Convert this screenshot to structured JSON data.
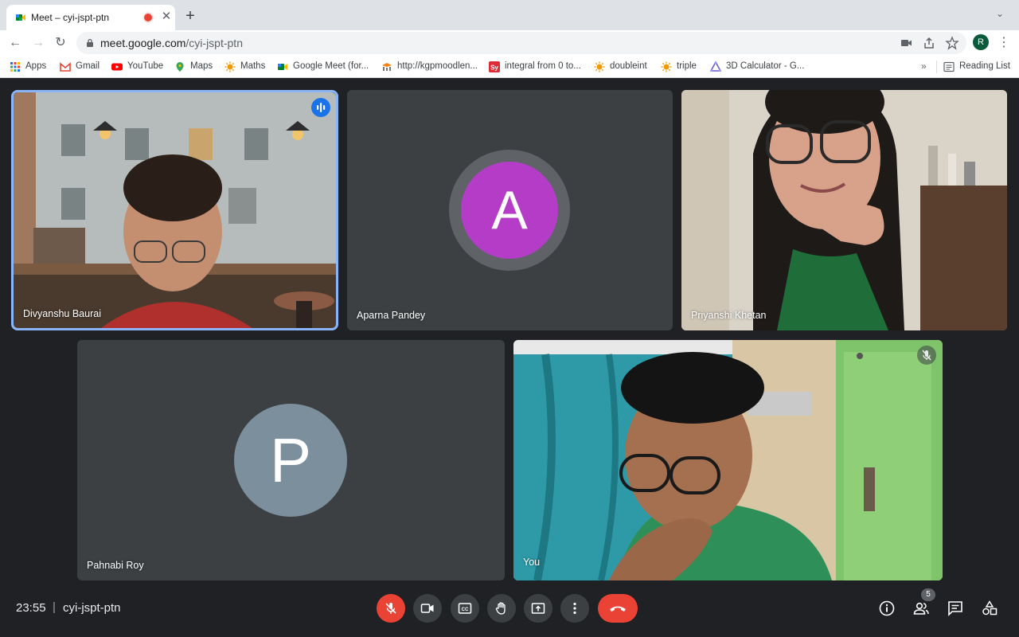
{
  "browser": {
    "tab_title": "Meet – cyi-jspt-ptn",
    "url_host": "meet.google.com",
    "url_path": "/cyi-jspt-ptn",
    "profile_initial": "R",
    "bookmarks": [
      {
        "label": "Apps",
        "icon": "apps-grid-icon"
      },
      {
        "label": "Gmail",
        "icon": "gmail-icon"
      },
      {
        "label": "YouTube",
        "icon": "youtube-icon"
      },
      {
        "label": "Maps",
        "icon": "maps-icon"
      },
      {
        "label": "Maths",
        "icon": "sun-icon"
      },
      {
        "label": "Google Meet (for...",
        "icon": "meet-icon"
      },
      {
        "label": "http://kgpmoodlen...",
        "icon": "moodle-icon"
      },
      {
        "label": "integral from 0 to...",
        "icon": "symbolab-icon"
      },
      {
        "label": "doubleint",
        "icon": "sun-icon"
      },
      {
        "label": "triple",
        "icon": "sun-icon"
      },
      {
        "label": "3D Calculator - G...",
        "icon": "geogebra-icon"
      }
    ],
    "reading_list": "Reading List"
  },
  "meet": {
    "participants": [
      {
        "name": "Divyanshu Baurai",
        "type": "video",
        "speaking": true
      },
      {
        "name": "Aparna Pandey",
        "type": "avatar",
        "initial": "A",
        "avatar_color": "#b43cc7"
      },
      {
        "name": "Priyanshi Khetan",
        "type": "video"
      },
      {
        "name": "Pahnabi Roy",
        "type": "avatar",
        "initial": "P",
        "avatar_color": "#7b8f9c"
      },
      {
        "name": "You",
        "type": "video",
        "muted": true
      }
    ],
    "bottom_bar": {
      "time": "23:55",
      "separator": "|",
      "meeting_code": "cyi-jspt-ptn",
      "people_count": "5"
    }
  },
  "colors": {
    "background": "#202124",
    "tile": "#3c4043",
    "danger": "#ea4335",
    "active_speaker": "#8ab4f8"
  }
}
